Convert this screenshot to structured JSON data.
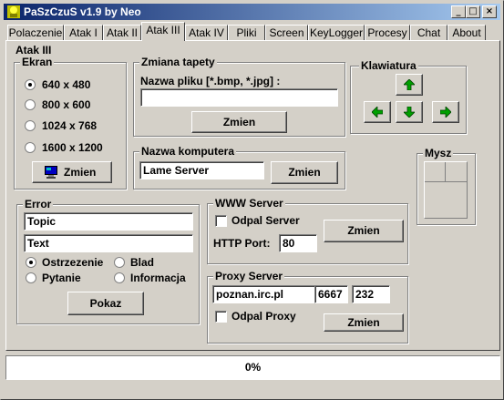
{
  "window": {
    "title": "PaSzCzuS v1.9 by Neo",
    "minimize": "_",
    "maximize": "□",
    "close": "×"
  },
  "tabs": [
    "Polaczenie",
    "Atak I",
    "Atak II",
    "Atak III",
    "Atak IV",
    "Pliki",
    "Screen",
    "KeyLogger",
    "Procesy",
    "Chat",
    "About"
  ],
  "active_tab": "Atak III",
  "panel_title": "Atak III",
  "ekran": {
    "title": "Ekran",
    "options": [
      "640 x 480",
      "800 x 600",
      "1024 x 768",
      "1600 x 1200"
    ],
    "selected": "640 x 480",
    "button": "Zmien"
  },
  "tapeta": {
    "title": "Zmiana tapety",
    "label": "Nazwa pliku [*.bmp, *.jpg] :",
    "value": "",
    "button": "Zmien"
  },
  "komputer": {
    "title": "Nazwa komputera",
    "value": "Lame Server",
    "button": "Zmien"
  },
  "klawiatura": {
    "title": "Klawiatura",
    "up": "up-arrow",
    "left": "left-arrow",
    "down": "down-arrow",
    "right": "right-arrow"
  },
  "mysz": {
    "title": "Mysz"
  },
  "error": {
    "title": "Error",
    "topic": "Topic",
    "text": "Text",
    "options": [
      "Ostrzezenie",
      "Blad",
      "Pytanie",
      "Informacja"
    ],
    "selected": "Ostrzezenie",
    "button": "Pokaz"
  },
  "www": {
    "title": "WWW Server",
    "checkbox": "Odpal Server",
    "port_label": "HTTP Port:",
    "port": "80",
    "button": "Zmien"
  },
  "proxy": {
    "title": "Proxy Server",
    "host": "poznan.irc.pl",
    "port1": "6667",
    "port2": "232",
    "checkbox": "Odpal Proxy",
    "button": "Zmien"
  },
  "status": {
    "progress": "0%"
  },
  "colors": {
    "titlebar_start": "#0a246a",
    "titlebar_end": "#a6caf0",
    "arrow_green": "#00a000",
    "face": "#d4d0c8"
  }
}
